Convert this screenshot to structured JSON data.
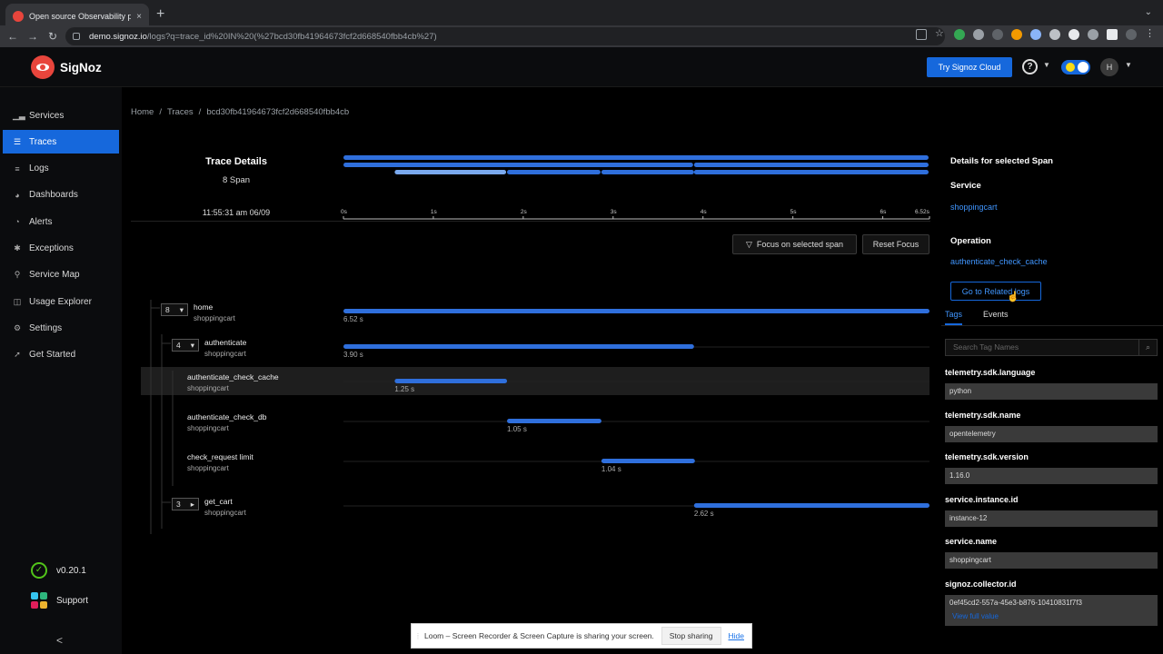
{
  "browser": {
    "tab_title": "Open source Observability pla",
    "tab_close": "×",
    "new_tab": "+",
    "url_host": "demo.signoz.io",
    "url_path": "/logs?q=trace_id%20IN%20(%27bcd30fb41964673fcf2d668540fbb4cb%27)"
  },
  "header": {
    "app_name": "SigNoz",
    "try_cloud": "Try Signoz Cloud",
    "help": "?",
    "avatar": "H"
  },
  "sidebar": {
    "items": [
      {
        "label": "Services",
        "icon": "chart-icon",
        "glyph": "▁▃"
      },
      {
        "label": "Traces",
        "icon": "list-icon",
        "glyph": "☰"
      },
      {
        "label": "Logs",
        "icon": "logs-icon",
        "glyph": "≡"
      },
      {
        "label": "Dashboards",
        "icon": "dashboard-icon",
        "glyph": "◕"
      },
      {
        "label": "Alerts",
        "icon": "alert-icon",
        "glyph": "◔"
      },
      {
        "label": "Exceptions",
        "icon": "bug-icon",
        "glyph": "✱"
      },
      {
        "label": "Service Map",
        "icon": "deployment-icon",
        "glyph": "⚲"
      },
      {
        "label": "Usage Explorer",
        "icon": "line-chart-icon",
        "glyph": "◫"
      },
      {
        "label": "Settings",
        "icon": "gear-icon",
        "glyph": "⚙"
      },
      {
        "label": "Get Started",
        "icon": "rocket-icon",
        "glyph": "➚"
      }
    ],
    "version": "v0.20.1",
    "support": "Support",
    "collapse": "<"
  },
  "breadcrumb": {
    "home": "Home",
    "sep": "/",
    "traces": "Traces",
    "trace_id": "bcd30fb41964673fcf2d668540fbb4cb"
  },
  "trace": {
    "title": "Trace Details",
    "span_count": "8 Span",
    "start_time": "11:55:31 am 06/09",
    "ticks": [
      "0s",
      "1s",
      "2s",
      "3s",
      "4s",
      "5s",
      "6s",
      "6.52s"
    ],
    "tick_values": [
      0,
      1,
      2,
      3,
      4,
      5,
      6,
      6.52
    ],
    "total_duration": 6.52,
    "focus_button": "Focus on selected span",
    "reset_button": "Reset Focus",
    "spans": [
      {
        "name": "home",
        "service": "shoppingcart",
        "count": "8",
        "start": 0,
        "duration": 6.52,
        "duration_label": "6.52 s",
        "level": 0
      },
      {
        "name": "authenticate",
        "service": "shoppingcart",
        "count": "4",
        "start": 0,
        "duration": 3.9,
        "duration_label": "3.90 s",
        "level": 1
      },
      {
        "name": "authenticate_check_cache",
        "service": "shoppingcart",
        "count": "",
        "start": 0.57,
        "duration": 1.25,
        "duration_label": "1.25 s",
        "level": 2,
        "selected": true
      },
      {
        "name": "authenticate_check_db",
        "service": "shoppingcart",
        "count": "",
        "start": 1.82,
        "duration": 1.05,
        "duration_label": "1.05 s",
        "level": 2
      },
      {
        "name": "check_request limit",
        "service": "shoppingcart",
        "count": "",
        "start": 2.87,
        "duration": 1.04,
        "duration_label": "1.04 s",
        "level": 2
      },
      {
        "name": "get_cart",
        "service": "shoppingcart",
        "count": "3",
        "start": 3.9,
        "duration": 2.62,
        "duration_label": "2.62 s",
        "level": 1
      }
    ]
  },
  "details": {
    "title": "Details for selected Span",
    "service_label": "Service",
    "service_value": "shoppingcart",
    "operation_label": "Operation",
    "operation_value": "authenticate_check_cache",
    "related_logs": "Go to Related logs",
    "tab_tags": "Tags",
    "tab_events": "Events",
    "search_placeholder": "Search Tag Names",
    "tags": [
      {
        "key": "telemetry.sdk.language",
        "value": "python"
      },
      {
        "key": "telemetry.sdk.name",
        "value": "opentelemetry"
      },
      {
        "key": "telemetry.sdk.version",
        "value": "1.16.0"
      },
      {
        "key": "service.instance.id",
        "value": "instance-12"
      },
      {
        "key": "service.name",
        "value": "shoppingcart"
      },
      {
        "key": "signoz.collector.id",
        "value": "0ef45cd2-557a-45e3-b876-10410831f7f3"
      }
    ],
    "view_full": "View full value"
  },
  "loom": {
    "message": "Loom – Screen Recorder & Screen Capture is sharing your screen.",
    "stop": "Stop sharing",
    "hide": "Hide"
  },
  "colors": {
    "accent": "#1668dc",
    "span_bar": "#2f6fdc",
    "span_selected": "#7aa9ee"
  }
}
